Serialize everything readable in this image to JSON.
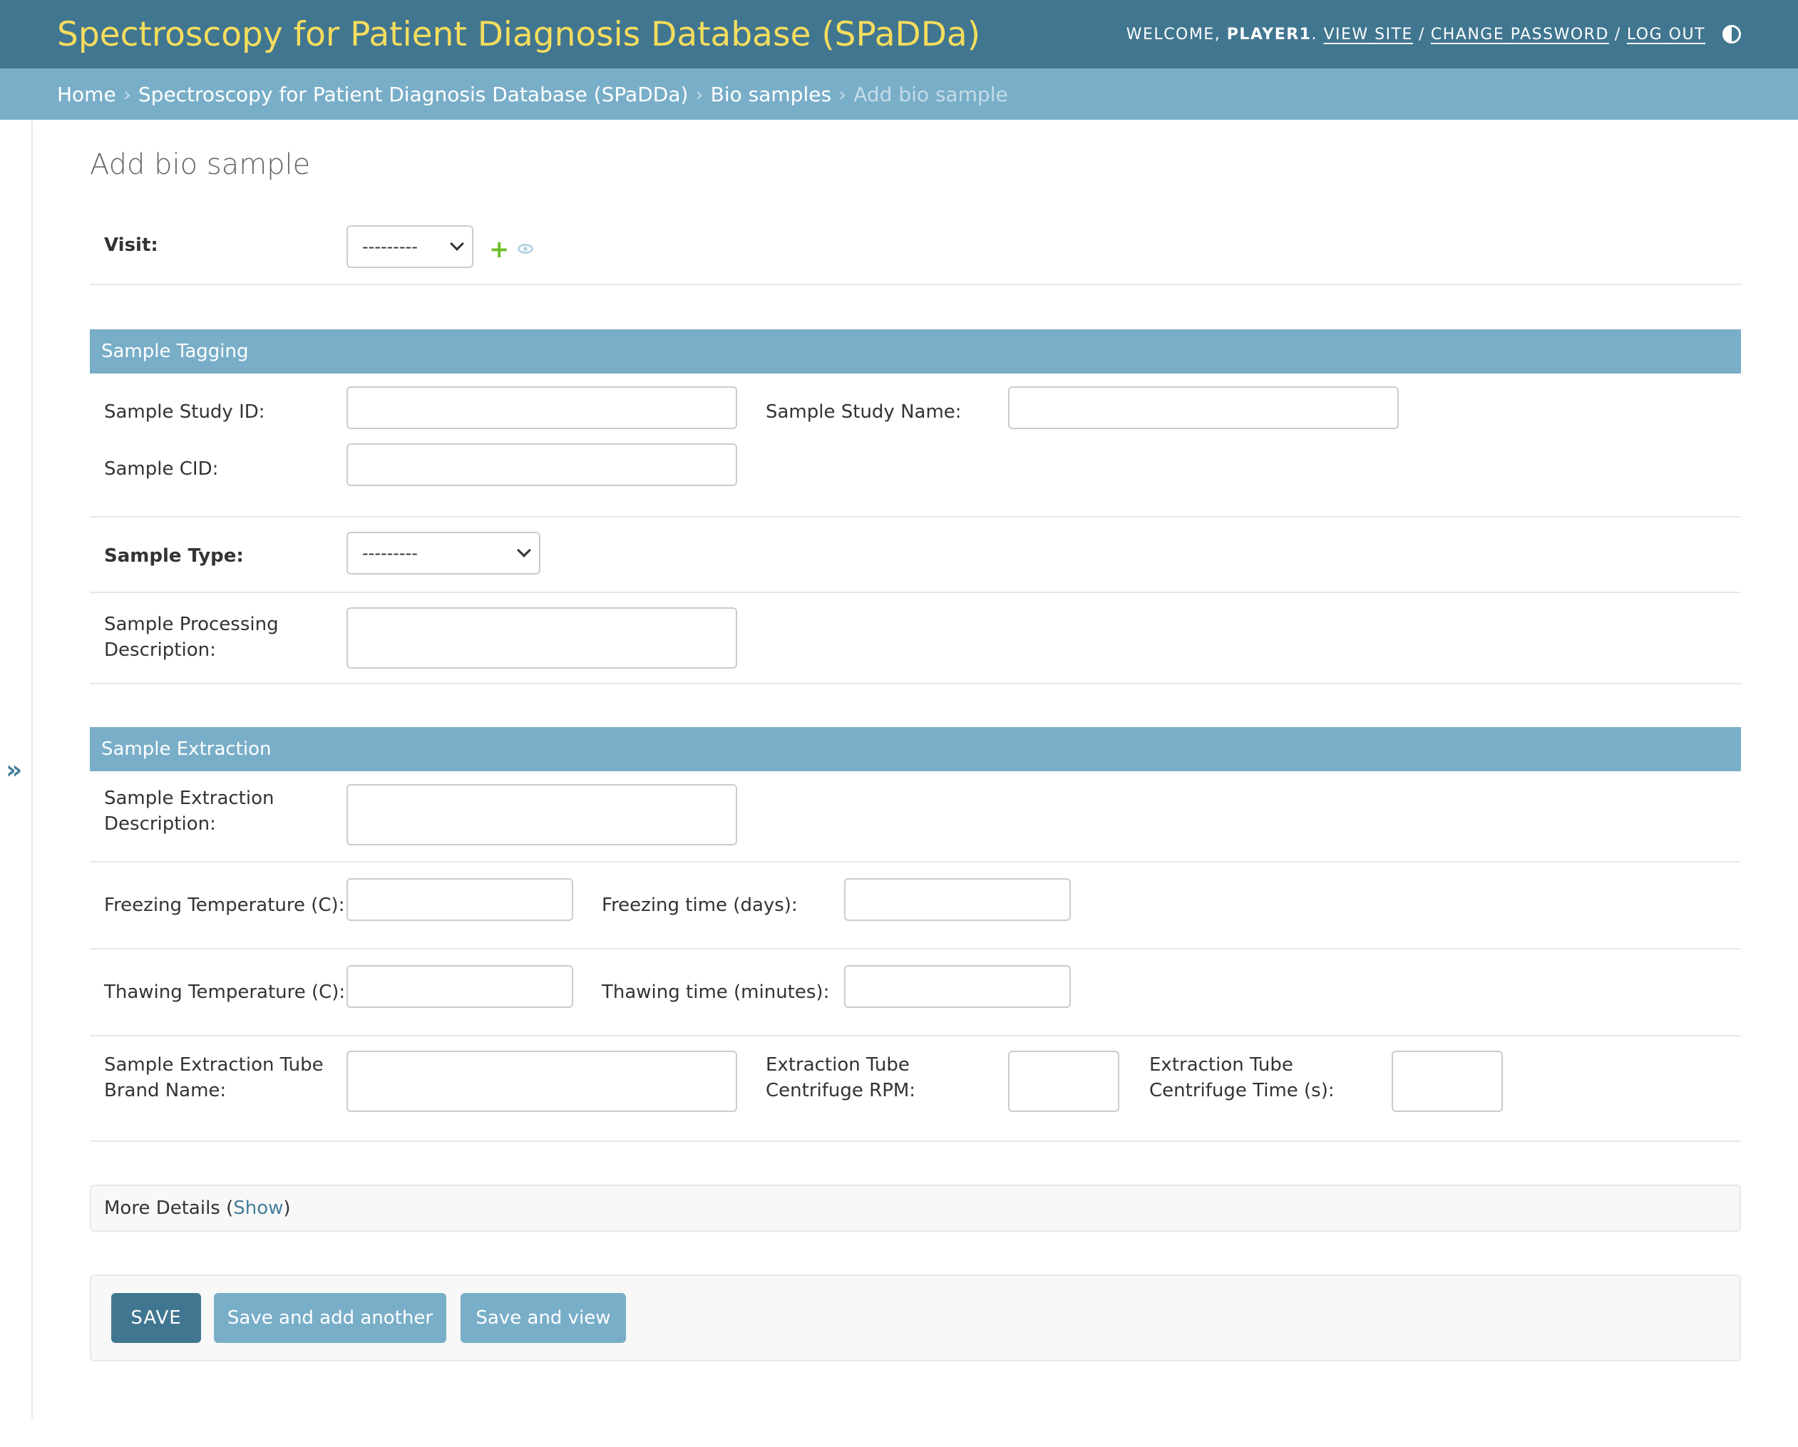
{
  "header": {
    "site_name": "Spectroscopy for Patient Diagnosis Database (SPaDDa)",
    "welcome_text": "WELCOME,",
    "username": "PLAYER1",
    "period": ".",
    "view_site": "VIEW SITE",
    "sep1": "/",
    "change_password": "CHANGE PASSWORD",
    "sep2": "/",
    "log_out": "LOG OUT"
  },
  "breadcrumbs": {
    "home": "Home",
    "app": "Spectroscopy for Patient Diagnosis Database (SPaDDa)",
    "model": "Bio samples",
    "current": "Add bio sample",
    "arrow": "›"
  },
  "sidebar": {
    "toggle": "»"
  },
  "page": {
    "title": "Add bio sample"
  },
  "form": {
    "visit": {
      "label": "Visit:",
      "value": "---------"
    },
    "sample_tagging": {
      "title": "Sample Tagging",
      "study_id_label": "Sample Study ID:",
      "study_name_label": "Sample Study Name:",
      "cid_label": "Sample CID:"
    },
    "sample_type": {
      "label": "Sample Type:",
      "value": "---------"
    },
    "processing_description_label": "Sample Processing Description:",
    "sample_extraction": {
      "title": "Sample Extraction",
      "description_label": "Sample Extraction Description:",
      "freezing_temp_label": "Freezing Temperature (C):",
      "freezing_time_label": "Freezing time (days):",
      "thawing_temp_label": "Thawing Temperature (C):",
      "thawing_time_label": "Thawing time (minutes):",
      "tube_brand_label": "Sample Extraction Tube Brand Name:",
      "centrifuge_rpm_label": "Extraction Tube Centrifuge RPM:",
      "centrifuge_time_label": "Extraction Tube Centrifuge Time (s):"
    },
    "more_details": {
      "label": "More Details (",
      "show": "Show",
      "close": ")"
    }
  },
  "buttons": {
    "save": "SAVE",
    "save_add_another": "Save and add another",
    "save_view": "Save and view"
  }
}
